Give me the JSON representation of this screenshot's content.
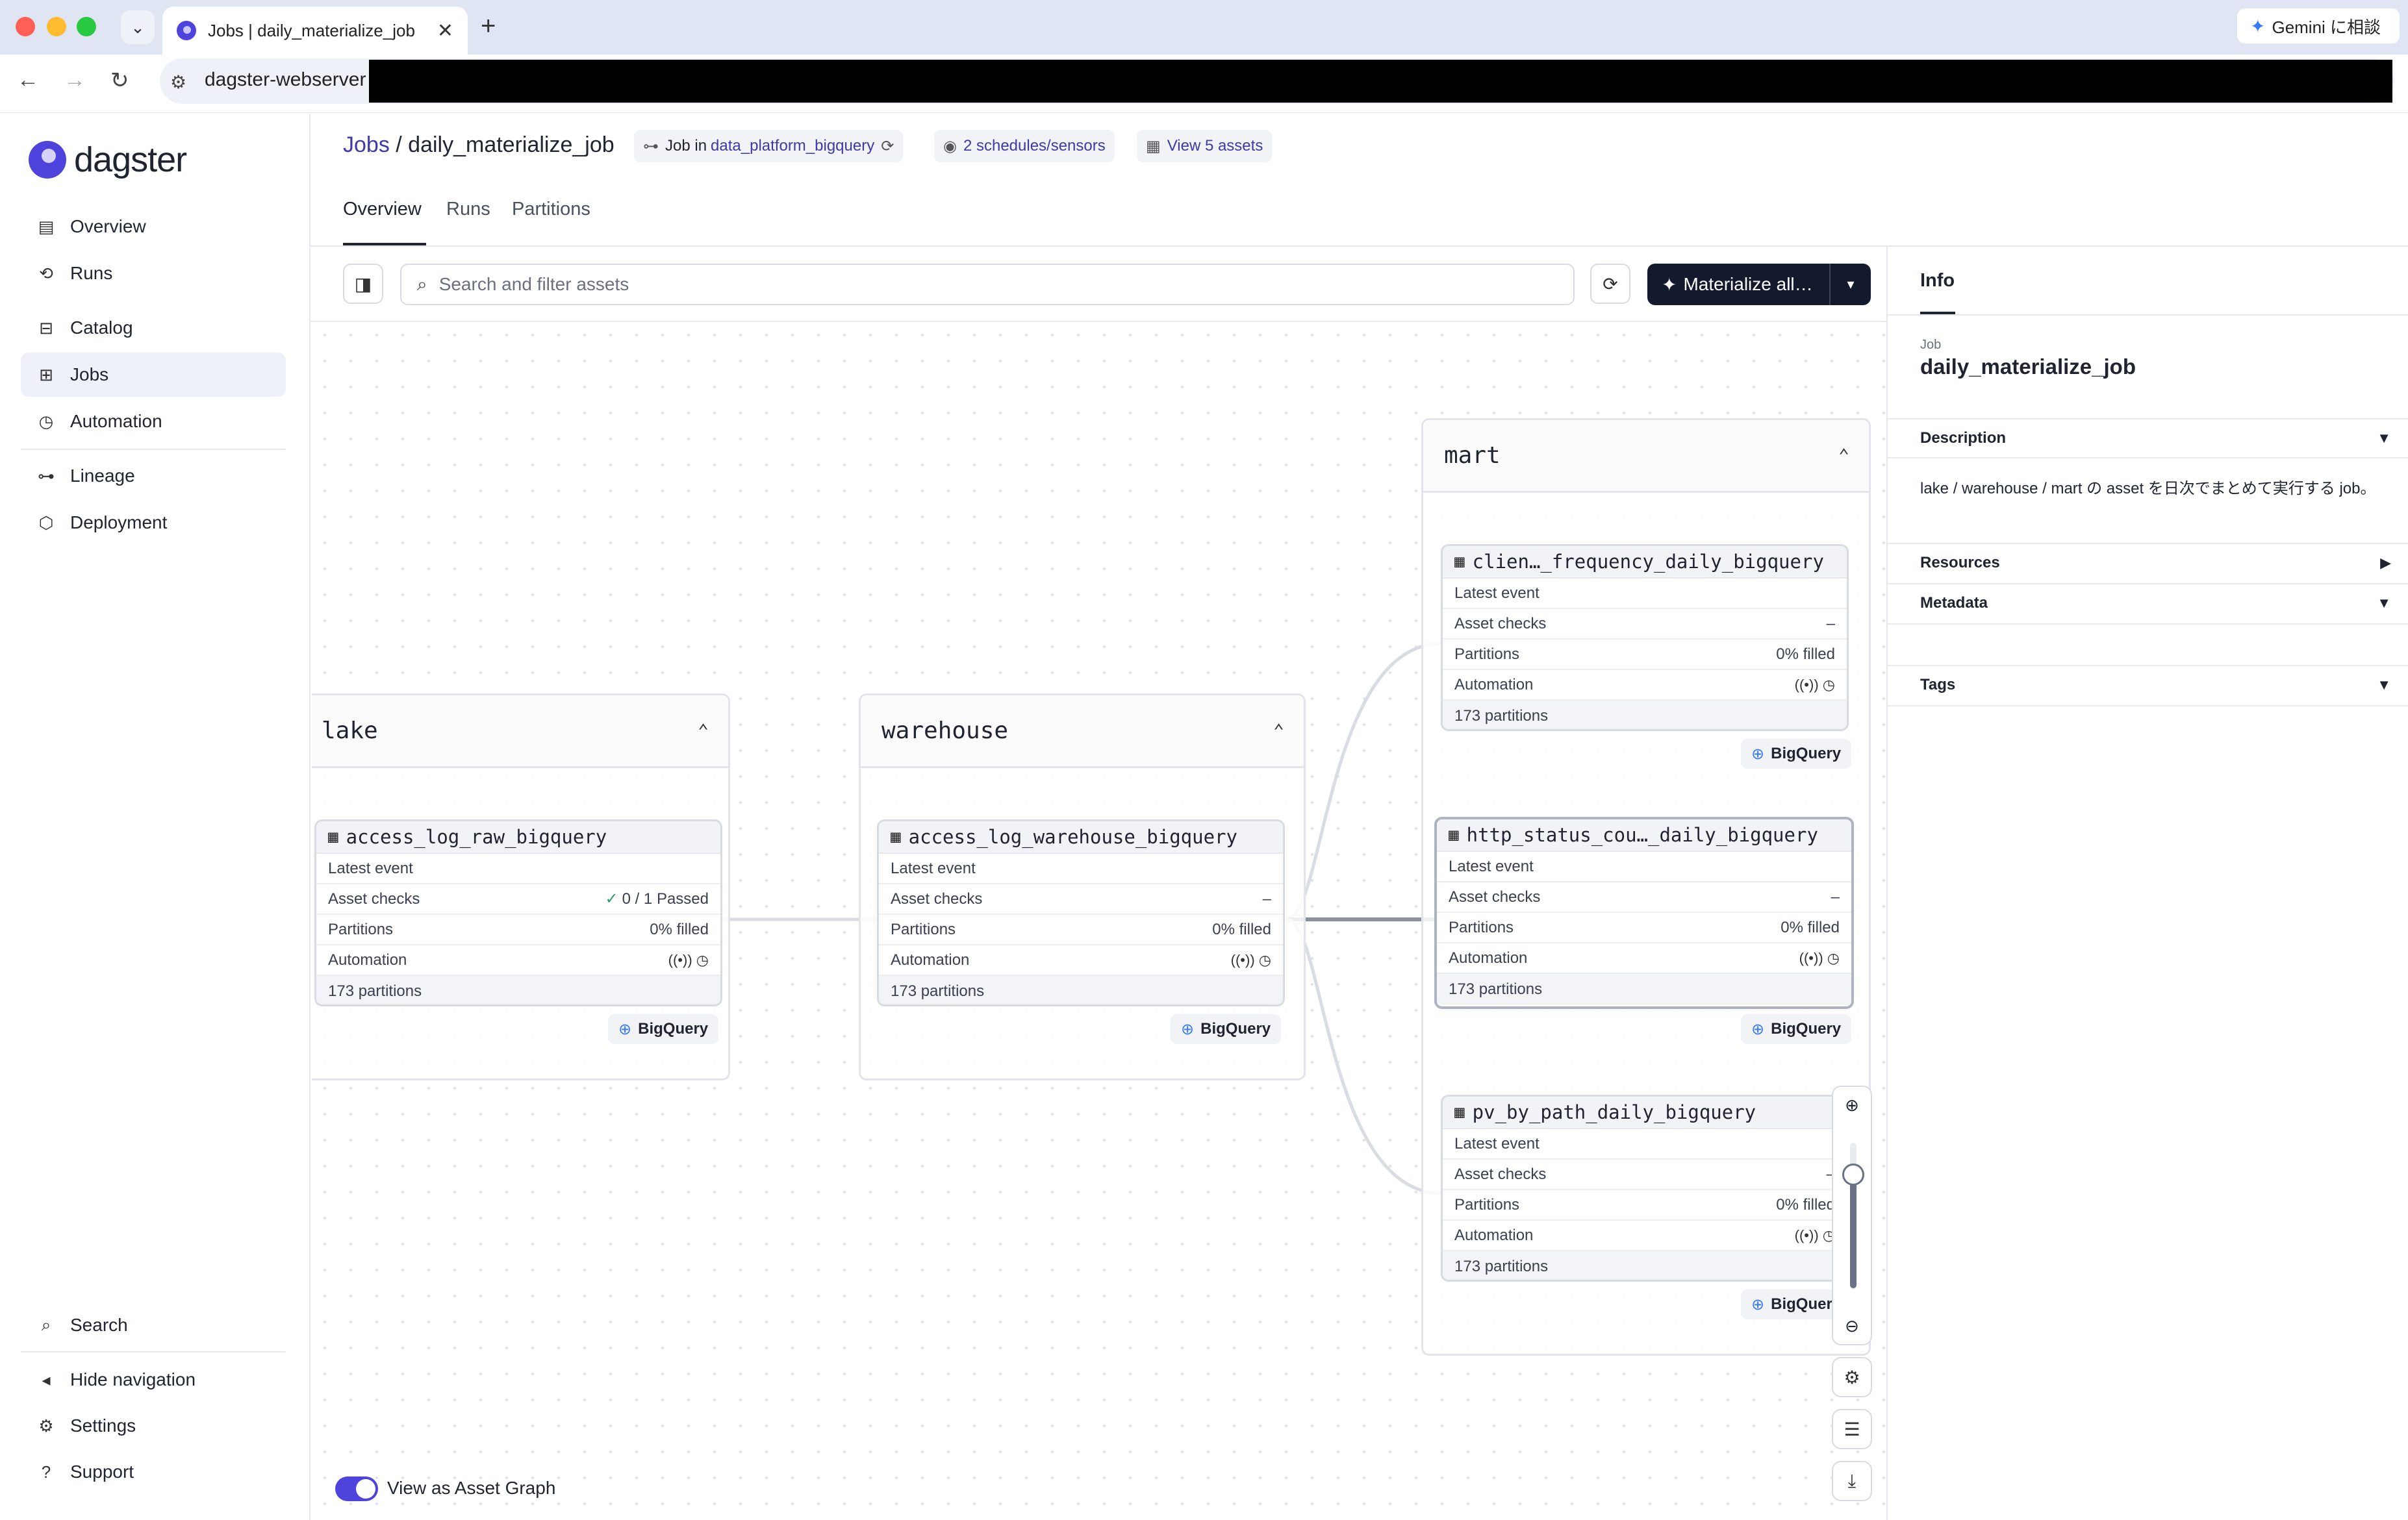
{
  "browser": {
    "tab_title": "Jobs | daily_materialize_job",
    "close_glyph": "✕",
    "new_tab_glyph": "+",
    "url": "dagster-webserver",
    "gemini_label": "Gemini に相談"
  },
  "sidebar": {
    "logo_text": "dagster",
    "items": [
      {
        "label": "Overview",
        "icon": "overview-icon"
      },
      {
        "label": "Runs",
        "icon": "runs-icon"
      },
      {
        "label": "Catalog",
        "icon": "catalog-icon"
      },
      {
        "label": "Jobs",
        "icon": "jobs-icon",
        "active": true
      },
      {
        "label": "Automation",
        "icon": "automation-icon"
      },
      {
        "label": "Lineage",
        "icon": "lineage-icon"
      },
      {
        "label": "Deployment",
        "icon": "deployment-icon"
      }
    ],
    "bottom": [
      {
        "label": "Search",
        "icon": "search-icon"
      },
      {
        "label": "Hide navigation",
        "icon": "hide-navigation-icon"
      },
      {
        "label": "Settings",
        "icon": "settings-icon"
      },
      {
        "label": "Support",
        "icon": "support-icon"
      }
    ]
  },
  "header": {
    "crumb_root": "Jobs",
    "crumb_sep": " / ",
    "crumb_job": "daily_materialize_job",
    "chip_job_prefix": "Job in ",
    "chip_job_location": "data_platform_bigquery",
    "chip_schedules": "2 schedules/sensors",
    "chip_assets": "View 5 assets",
    "tabs": [
      "Overview",
      "Runs",
      "Partitions"
    ]
  },
  "toolbar": {
    "search_placeholder": "Search and filter assets",
    "materialize_label": "Materialize all...",
    "materialize_label_shown": "Materialize all…"
  },
  "graph": {
    "groups": {
      "lake": "lake",
      "warehouse": "warehouse",
      "mart": "mart"
    },
    "row_labels": {
      "latest": "Latest event",
      "checks": "Asset checks",
      "partitions": "Partitions",
      "automation": "Automation"
    },
    "nodes": {
      "raw": {
        "name": "access_log_raw_bigquery",
        "checks": "0 / 1 Passed",
        "partitions": "0% filled",
        "count": "173 partitions",
        "tag": "BigQuery"
      },
      "wh": {
        "name": "access_log_warehouse_bigquery",
        "checks": "–",
        "partitions": "0% filled",
        "count": "173 partitions",
        "tag": "BigQuery"
      },
      "client": {
        "name": "clien…_frequency_daily_bigquery",
        "checks": "–",
        "partitions": "0% filled",
        "count": "173 partitions",
        "tag": "BigQuery"
      },
      "http": {
        "name": "http_status_cou…_daily_bigquery",
        "checks": "–",
        "partitions": "0% filled",
        "count": "173 partitions",
        "tag": "BigQuery"
      },
      "pv": {
        "name": "pv_by_path_daily_bigquery",
        "checks": "–",
        "partitions": "0% filled",
        "count": "173 partitions",
        "tag": "BigQuery"
      }
    },
    "view_as_asset_graph": "View as Asset Graph",
    "zoom_level": 0.7
  },
  "info": {
    "tab": "Info",
    "kicker": "Job",
    "job_name": "daily_materialize_job",
    "sections": {
      "description": "Description",
      "resources": "Resources",
      "metadata": "Metadata",
      "tags": "Tags"
    },
    "description_text": "lake / warehouse / mart の asset を日次でまとめて実行する job。"
  },
  "colors": {
    "accent": "#4f43dd",
    "primary_button": "#141a2e",
    "link": "#3e3aa8",
    "check_pass": "#2f9e6c"
  }
}
